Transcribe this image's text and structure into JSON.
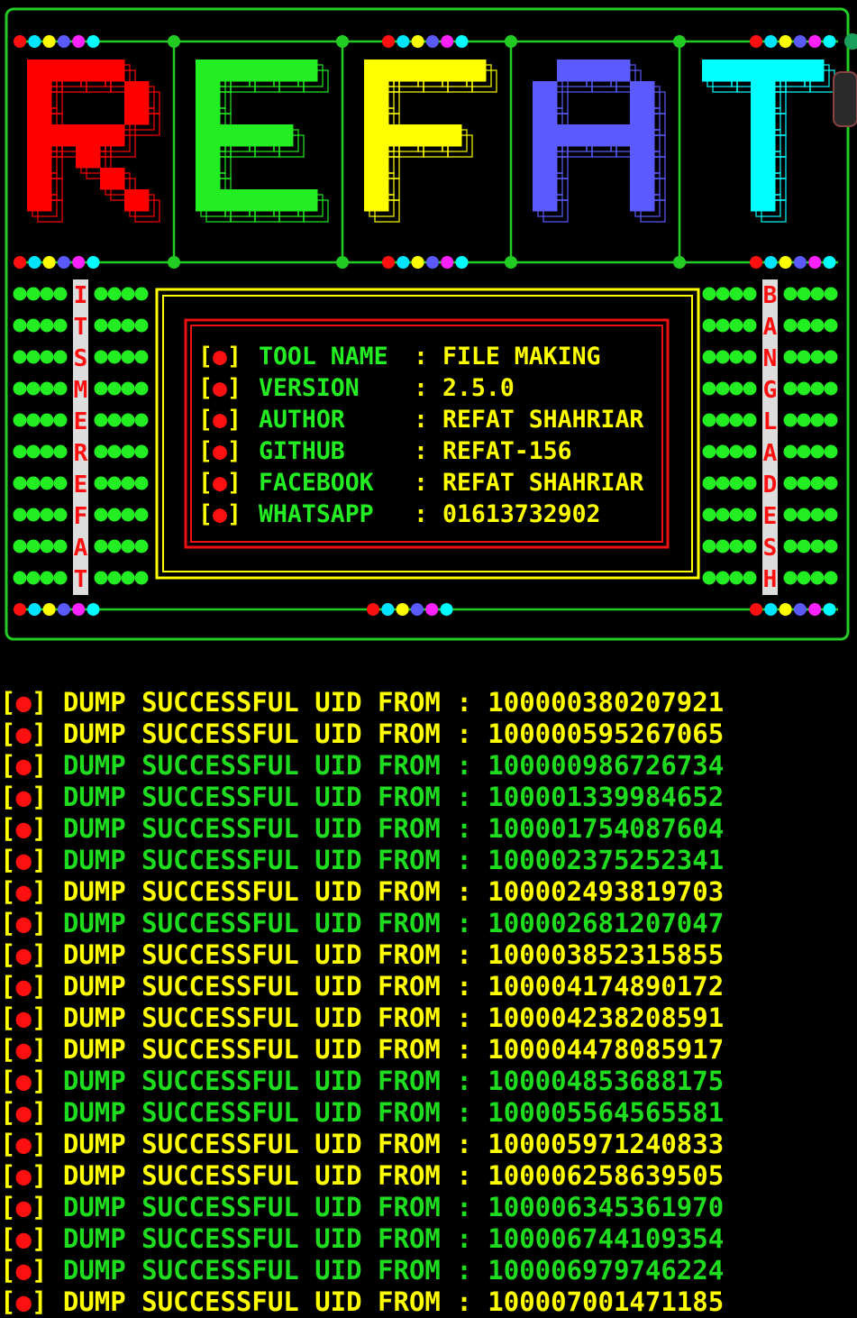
{
  "banner": {
    "logo_letters": [
      {
        "char": "R",
        "color": "#ff0000"
      },
      {
        "char": "E",
        "color": "#22ee22"
      },
      {
        "char": "F",
        "color": "#ffff00"
      },
      {
        "char": "A",
        "color": "#5a5aff"
      },
      {
        "char": "T",
        "color": "#00ffff"
      }
    ],
    "left_vertical": "ITSMEREFAT",
    "right_vertical": "BANGLADESH",
    "info_bullet": "[●]",
    "info": [
      {
        "key": "TOOL NAME",
        "value": "FILE MAKING"
      },
      {
        "key": "VERSION",
        "value": "2.5.0"
      },
      {
        "key": "AUTHOR",
        "value": "REFAT SHAHRIAR"
      },
      {
        "key": "GITHUB",
        "value": "REFAT-156"
      },
      {
        "key": "FACEBOOK",
        "value": "REFAT SHAHRIAR"
      },
      {
        "key": "WHATSAPP",
        "value": "01613732902"
      }
    ],
    "colors": {
      "border": "#22cc22",
      "box_outer": "#ffff00",
      "box_inner": "#ee1111",
      "key": "#22ee22",
      "value": "#ffff00"
    }
  },
  "log": {
    "prefix": "[●]",
    "message": "DUMP SUCCESSFUL UID FROM",
    "separator": ":",
    "entries": [
      {
        "uid": "100000380207921",
        "color": "yellow"
      },
      {
        "uid": "100000595267065",
        "color": "yellow"
      },
      {
        "uid": "100000986726734",
        "color": "green"
      },
      {
        "uid": "100001339984652",
        "color": "green"
      },
      {
        "uid": "100001754087604",
        "color": "green"
      },
      {
        "uid": "100002375252341",
        "color": "green"
      },
      {
        "uid": "100002493819703",
        "color": "yellow"
      },
      {
        "uid": "100002681207047",
        "color": "green"
      },
      {
        "uid": "100003852315855",
        "color": "yellow"
      },
      {
        "uid": "100004174890172",
        "color": "yellow"
      },
      {
        "uid": "100004238208591",
        "color": "yellow"
      },
      {
        "uid": "100004478085917",
        "color": "yellow"
      },
      {
        "uid": "100004853688175",
        "color": "green"
      },
      {
        "uid": "100005564565581",
        "color": "green"
      },
      {
        "uid": "100005971240833",
        "color": "yellow"
      },
      {
        "uid": "100006258639505",
        "color": "yellow"
      },
      {
        "uid": "100006345361970",
        "color": "green"
      },
      {
        "uid": "100006744109354",
        "color": "green"
      },
      {
        "uid": "100006979746224",
        "color": "green"
      },
      {
        "uid": "100007001471185",
        "color": "yellow"
      }
    ]
  }
}
